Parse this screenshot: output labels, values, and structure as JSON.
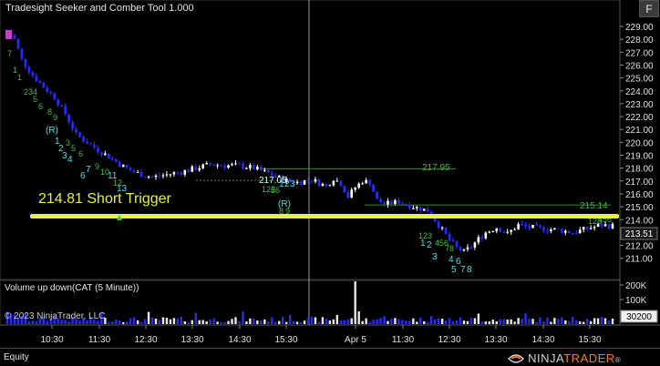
{
  "window": {
    "title": "Tradesight Seeker and Comber Tool 1.000",
    "f_button": "F"
  },
  "price_axis": {
    "labels": [
      "229.00",
      "228.00",
      "227.00",
      "226.00",
      "225.00",
      "224.00",
      "223.00",
      "222.00",
      "221.00",
      "220.00",
      "219.00",
      "218.00",
      "217.00",
      "216.00",
      "215.00",
      "214.00",
      "213.00",
      "212.00",
      "211.00"
    ],
    "current_price": "213.51"
  },
  "volume_axis": {
    "labels": [
      "200K",
      "100K"
    ],
    "current_volume": "30200"
  },
  "time_axis": {
    "labels": [
      "10:30",
      "11:30",
      "12:30",
      "13:30",
      "14:30",
      "15:30",
      "Apr 5",
      "11:30",
      "12:30",
      "13:30",
      "14:30",
      "15:30"
    ]
  },
  "annotations": {
    "short_trigger": "214.81 Short Trigger",
    "level_217_05": "217.05",
    "level_217_95": "217.95",
    "level_215_14": "215.14"
  },
  "volume_panel": {
    "title": "Volume up down(CAT (5 Minute))"
  },
  "copyright": "© 2023 NinjaTrader, LLC",
  "footer": {
    "tab_label": "Equity",
    "logo_text_left": "NINJA",
    "logo_text_right": "TRADER",
    "logo_trademark": "®"
  },
  "colors": {
    "background": "#000000",
    "up_bar": "#ffffff",
    "down_bar": "#2a2aff",
    "trigger_line": "#e6f23c",
    "level_line": "#2e8b2e",
    "sequential_counts": "#3fbf3f",
    "cyan_counts": "#4fe0e0",
    "logo_accent": "#f47d20"
  },
  "icons": [
    "ninjatrader-logo-icon",
    "up-arrow-marker-icon"
  ],
  "chart_data": {
    "type": "candlestick",
    "symbol": "CAT",
    "timeframe": "5 Minute",
    "ylim": [
      210.3,
      229.8
    ],
    "close_path": [
      [
        0,
        228.7
      ],
      [
        2,
        228.0
      ],
      [
        4,
        226.4
      ],
      [
        7,
        225.2
      ],
      [
        10,
        224.3
      ],
      [
        13,
        223.5
      ],
      [
        16,
        222.2
      ],
      [
        19,
        220.6
      ],
      [
        22,
        220.0
      ],
      [
        25,
        219.4
      ],
      [
        28,
        218.9
      ],
      [
        31,
        218.3
      ],
      [
        34,
        217.8
      ],
      [
        37,
        217.5
      ],
      [
        40,
        217.3
      ],
      [
        44,
        217.5
      ],
      [
        48,
        217.7
      ],
      [
        52,
        218.0
      ],
      [
        56,
        218.3
      ],
      [
        60,
        218.2
      ],
      [
        64,
        218.2
      ],
      [
        68,
        218.0
      ],
      [
        72,
        217.6
      ],
      [
        76,
        217.1
      ],
      [
        80,
        216.9
      ],
      [
        84,
        217.1
      ],
      [
        88,
        216.6
      ],
      [
        90,
        217.2
      ],
      [
        92,
        216.8
      ],
      [
        94,
        215.8
      ],
      [
        96,
        216.5
      ],
      [
        98,
        217.0
      ],
      [
        100,
        216.9
      ],
      [
        102,
        215.5
      ],
      [
        104,
        215.2
      ],
      [
        108,
        215.4
      ],
      [
        112,
        215.0
      ],
      [
        116,
        214.7
      ],
      [
        119,
        213.6
      ],
      [
        122,
        212.4
      ],
      [
        124,
        211.8
      ],
      [
        126,
        211.5
      ],
      [
        128,
        211.9
      ],
      [
        130,
        212.5
      ],
      [
        132,
        213.0
      ],
      [
        135,
        213.4
      ],
      [
        138,
        212.9
      ],
      [
        141,
        213.6
      ],
      [
        144,
        213.4
      ],
      [
        148,
        213.3
      ],
      [
        152,
        213.2
      ],
      [
        156,
        213.0
      ],
      [
        160,
        213.3
      ],
      [
        164,
        213.6
      ],
      [
        167,
        213.5
      ]
    ],
    "levels": [
      {
        "label": "217.05",
        "value": 217.05
      },
      {
        "label": "217.95",
        "value": 217.95
      },
      {
        "label": "215.14",
        "value": 215.14
      },
      {
        "label": "214.81 Short Trigger",
        "value": 214.81
      }
    ],
    "volume_axis_labels": [
      "200K",
      "100K"
    ],
    "last_volume": 30200,
    "last_price": 213.51
  }
}
